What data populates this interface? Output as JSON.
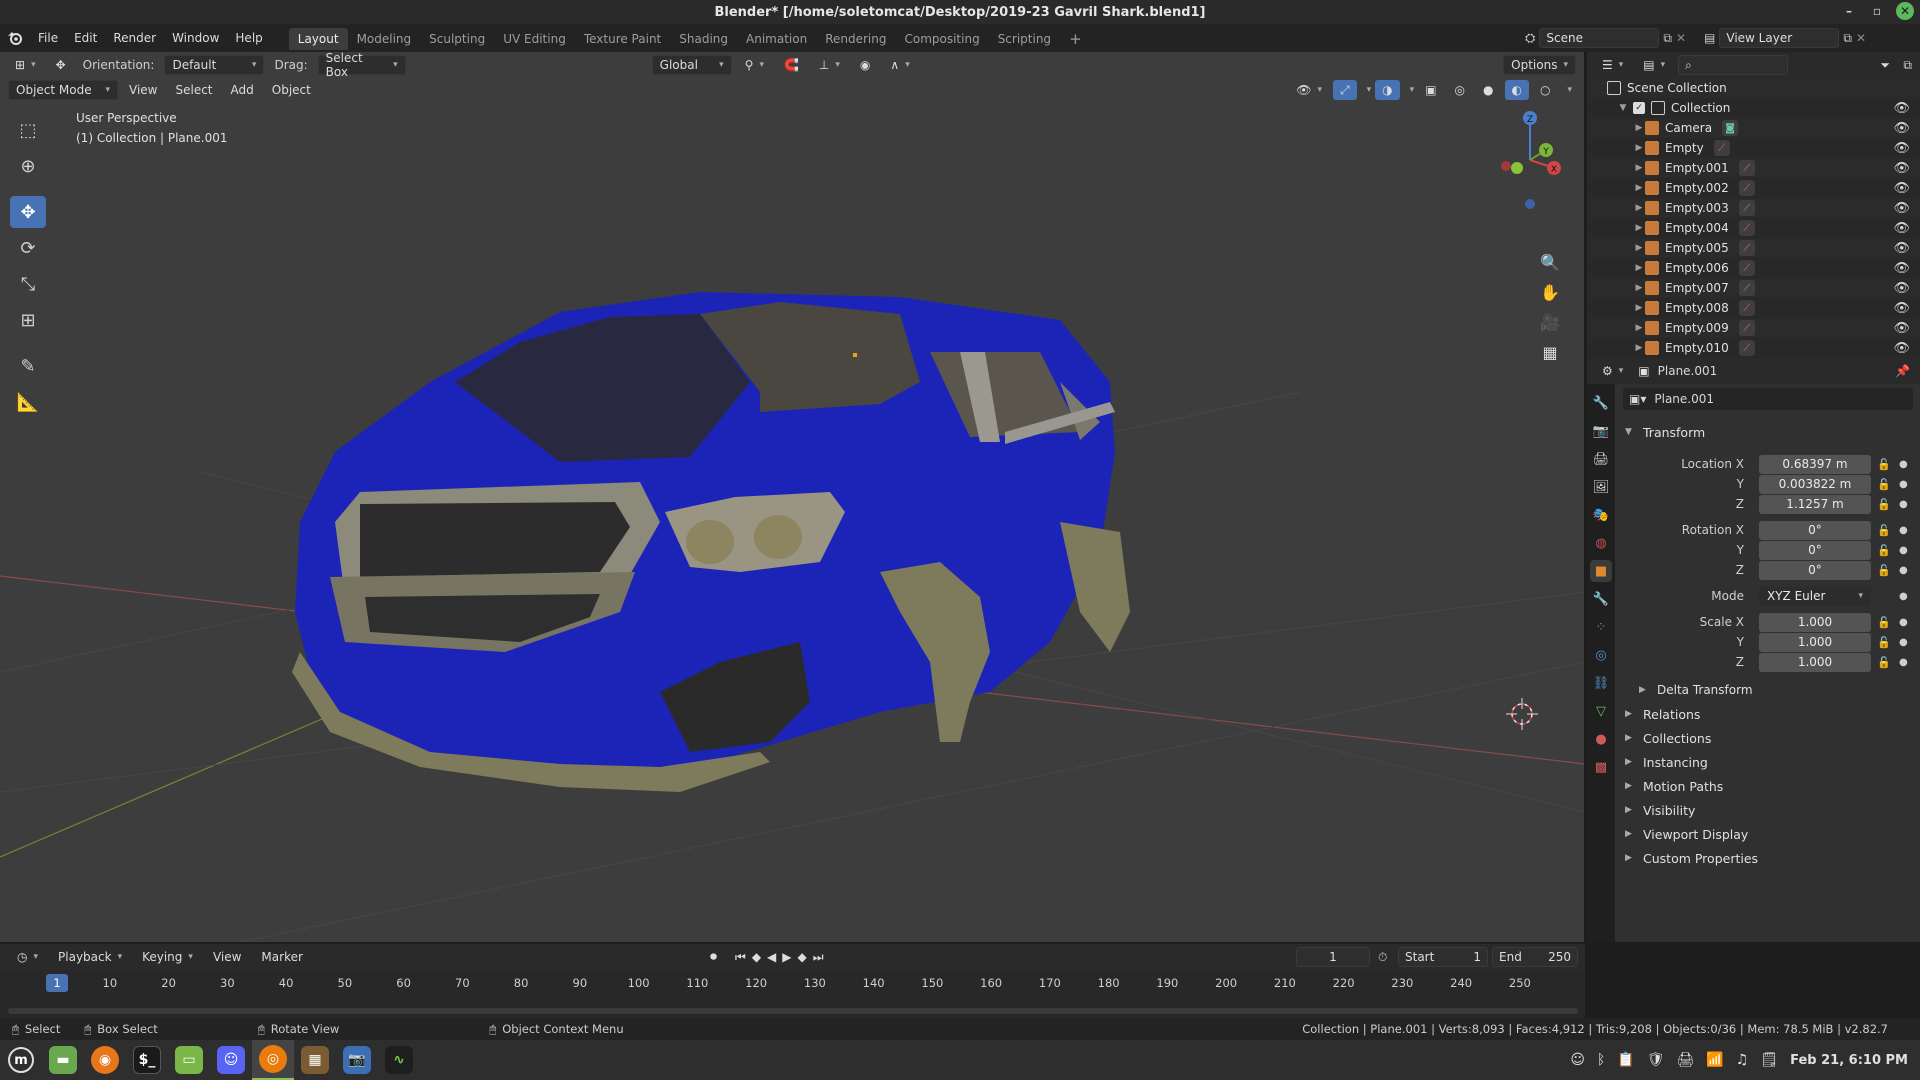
{
  "window": {
    "title": "Blender* [/home/soletomcat/Desktop/2019-23 Gavril Shark.blend1]"
  },
  "menubar": {
    "items": [
      "File",
      "Edit",
      "Render",
      "Window",
      "Help"
    ],
    "workspaces": [
      "Layout",
      "Modeling",
      "Sculpting",
      "UV Editing",
      "Texture Paint",
      "Shading",
      "Animation",
      "Rendering",
      "Compositing",
      "Scripting"
    ],
    "active_workspace": "Layout",
    "scene": "Scene",
    "view_layer": "View Layer"
  },
  "viewport_header": {
    "orientation_label": "Orientation:",
    "orientation_value": "Default",
    "drag_label": "Drag:",
    "drag_value": "Select Box",
    "transform_space": "Global",
    "options": "Options",
    "mode": "Object Mode",
    "menus": [
      "View",
      "Select",
      "Add",
      "Object"
    ]
  },
  "viewport": {
    "perspective": "User Perspective",
    "active": "(1) Collection | Plane.001",
    "car_color": "#1c24b8",
    "trim_color": "#7e7a5c"
  },
  "outliner": {
    "root": "Scene Collection",
    "collection": "Collection",
    "objects": [
      {
        "name": "Camera",
        "icon": "camera-data-icon"
      },
      {
        "name": "Empty",
        "icon": "empty-data-icon"
      },
      {
        "name": "Empty.001",
        "icon": "empty-data-icon"
      },
      {
        "name": "Empty.002",
        "icon": "empty-data-icon"
      },
      {
        "name": "Empty.003",
        "icon": "empty-data-icon"
      },
      {
        "name": "Empty.004",
        "icon": "empty-data-icon"
      },
      {
        "name": "Empty.005",
        "icon": "empty-data-icon"
      },
      {
        "name": "Empty.006",
        "icon": "empty-data-icon"
      },
      {
        "name": "Empty.007",
        "icon": "empty-data-icon"
      },
      {
        "name": "Empty.008",
        "icon": "empty-data-icon"
      },
      {
        "name": "Empty.009",
        "icon": "empty-data-icon"
      },
      {
        "name": "Empty.010",
        "icon": "empty-data-icon"
      }
    ]
  },
  "properties": {
    "header_object": "Plane.001",
    "object_name": "Plane.001",
    "transform_title": "Transform",
    "location": {
      "label": "Location X",
      "x": "0.68397 m",
      "y": "0.003822 m",
      "z": "1.1257 m"
    },
    "rotation": {
      "label": "Rotation X",
      "x": "0°",
      "y": "0°",
      "z": "0°"
    },
    "mode_label": "Mode",
    "mode_value": "XYZ Euler",
    "scale": {
      "label": "Scale X",
      "x": "1.000",
      "y": "1.000",
      "z": "1.000"
    },
    "axis_y": "Y",
    "axis_z": "Z",
    "delta_transform": "Delta Transform",
    "panels": [
      "Relations",
      "Collections",
      "Instancing",
      "Motion Paths",
      "Visibility",
      "Viewport Display",
      "Custom Properties"
    ]
  },
  "timeline": {
    "menus": [
      "Playback",
      "Keying",
      "View",
      "Marker"
    ],
    "current_frame": "1",
    "start_label": "Start",
    "start_value": "1",
    "end_label": "End",
    "end_value": "250",
    "ticks": [
      "1",
      "10",
      "20",
      "30",
      "40",
      "50",
      "60",
      "70",
      "80",
      "90",
      "100",
      "110",
      "120",
      "130",
      "140",
      "150",
      "160",
      "170",
      "180",
      "190",
      "200",
      "210",
      "220",
      "230",
      "240",
      "250"
    ]
  },
  "statusbar": {
    "select": "Select",
    "box_select": "Box Select",
    "rotate_view": "Rotate View",
    "context_menu": "Object Context Menu",
    "stats": "Collection | Plane.001 | Verts:8,093 | Faces:4,912 | Tris:9,208 | Objects:0/36 | Mem: 78.5 MiB | v2.82.7"
  },
  "taskbar": {
    "clock": "Feb 21, 6:10 PM"
  }
}
